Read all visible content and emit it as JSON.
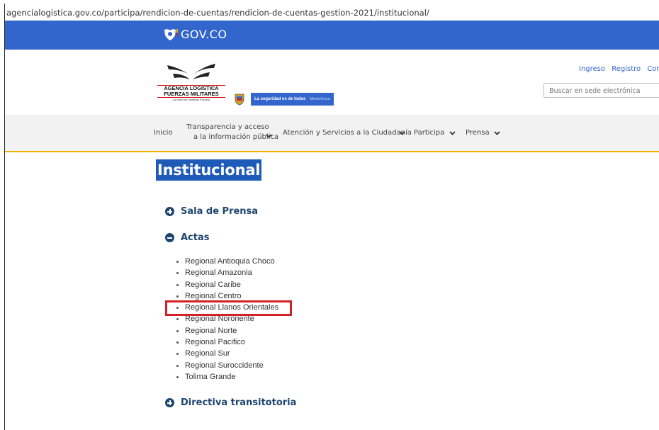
{
  "browser": {
    "url": "agencialogistica.gov.co/participa/rendicion-de-cuentas/rendicion-de-cuentas-gestion-2021/institucional/"
  },
  "govbar": {
    "brand": "GOV.CO"
  },
  "header": {
    "agency_logo": {
      "name_line1": "AGENCIA LOGÍSTICA",
      "name_line2": "FUERZAS MILITARES",
      "tagline": "La unión de nuestras Fuerzas"
    },
    "ministry_logo": {
      "text1": "La seguridad es de todos",
      "text2": "Mindefensa"
    },
    "top_links": [
      "Ingreso",
      "Registro",
      "Corre"
    ],
    "search_placeholder": "Buscar en sede electrónica"
  },
  "nav": {
    "items": [
      {
        "label": "Inicio"
      },
      {
        "label_line1": "Transparencia y acceso",
        "label_line2": "a la información pública"
      },
      {
        "label": "Atención y Servicios a la Ciudadanía"
      },
      {
        "label": "Participa"
      },
      {
        "label": "Prensa"
      }
    ]
  },
  "content": {
    "title": "Institucional",
    "sections": [
      {
        "label": "Sala de Prensa",
        "state": "collapsed"
      },
      {
        "label": "Actas",
        "state": "expanded"
      },
      {
        "label": "Directiva transitotoria",
        "state": "collapsed"
      }
    ],
    "actas_items": [
      "Regional Antioquia Choco",
      "Regional Amazonia",
      "Regional Caribe",
      "Regional Centro",
      "Regional Llanos Orientales",
      "Regional Nororiente",
      "Regional Norte",
      "Regional Pacifico",
      "Regional Sur",
      "Regional Suroccidente",
      "Tolima Grande"
    ],
    "highlighted_item": "Regional Llanos Orientales"
  },
  "colors": {
    "gov_blue": "#3366CC",
    "title_highlight": "#1E5BB8",
    "section_blue": "#1E4570",
    "nav_underline": "#F4B400",
    "annotation_red": "#D32027"
  }
}
